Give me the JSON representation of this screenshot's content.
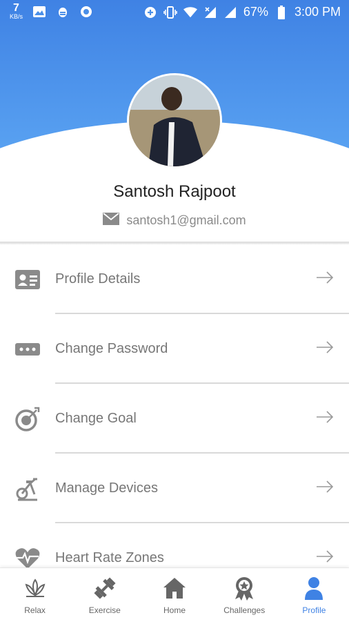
{
  "status_bar": {
    "net_speed_value": "7",
    "net_speed_unit": "KB/s",
    "battery": "67%",
    "time": "3:00 PM"
  },
  "profile": {
    "name": "Santosh Rajpoot",
    "email": "santosh1@gmail.com"
  },
  "menu": {
    "items": [
      {
        "label": "Profile Details",
        "icon": "id-card-icon"
      },
      {
        "label": "Change Password",
        "icon": "password-icon"
      },
      {
        "label": "Change Goal",
        "icon": "target-icon"
      },
      {
        "label": "Manage Devices",
        "icon": "exercise-bike-icon"
      },
      {
        "label": "Heart Rate Zones",
        "icon": "heart-rate-icon"
      }
    ]
  },
  "bottom_nav": {
    "items": [
      {
        "label": "Relax",
        "icon": "lotus-icon"
      },
      {
        "label": "Exercise",
        "icon": "dumbbell-icon"
      },
      {
        "label": "Home",
        "icon": "home-icon"
      },
      {
        "label": "Challenges",
        "icon": "medal-icon"
      },
      {
        "label": "Profile",
        "icon": "person-icon"
      }
    ],
    "active": "Profile"
  },
  "colors": {
    "header_top": "#3f82e4",
    "header_bottom": "#5aa3f2",
    "accent": "#3f82e4",
    "icon_gray": "#8a8a8a",
    "label_gray": "#777777"
  }
}
